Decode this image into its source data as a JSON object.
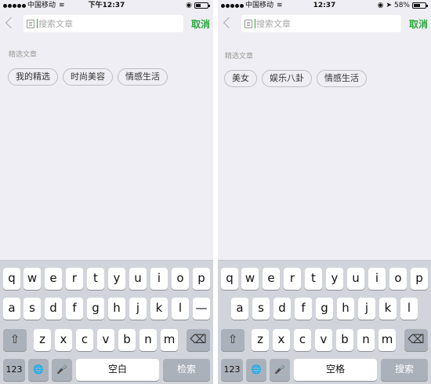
{
  "screens": [
    {
      "status": {
        "carrier": "中国移动",
        "time": "下午12:37",
        "battery_level": 0.45
      },
      "search": {
        "placeholder": "搜索文章",
        "cancel_label": "取消"
      },
      "featured": {
        "title": "精选文章",
        "tags": [
          "我的精选",
          "时尚美容",
          "情感生活"
        ]
      },
      "keyboard": {
        "space_label": "空白",
        "search_label": "检索",
        "numbers_label": "123"
      }
    },
    {
      "status": {
        "carrier": "中国移动",
        "time": "12:37",
        "battery_percent": "58%",
        "battery_level": 0.58
      },
      "search": {
        "placeholder": "搜索文章",
        "cancel_label": "取消"
      },
      "featured": {
        "title": "精选文章",
        "tags": [
          "美女",
          "娱乐八卦",
          "情感生活"
        ]
      },
      "keyboard": {
        "space_label": "空格",
        "search_label": "搜索",
        "numbers_label": "123"
      }
    }
  ],
  "keyboard_rows": {
    "row1": [
      "q",
      "w",
      "e",
      "r",
      "t",
      "y",
      "u",
      "i",
      "o",
      "p"
    ],
    "row2": [
      "a",
      "s",
      "d",
      "f",
      "g",
      "h",
      "j",
      "k",
      "l"
    ],
    "row3": [
      "z",
      "x",
      "c",
      "v",
      "b",
      "n",
      "m"
    ],
    "left_row2_extra": "—"
  },
  "icons": {
    "shift": "⇧",
    "delete": "⌫",
    "globe": "🌐",
    "mic": "🎤",
    "wifi": "≋",
    "lock": "◉",
    "location": "➤"
  },
  "colors": {
    "accent": "#2aa83b"
  }
}
